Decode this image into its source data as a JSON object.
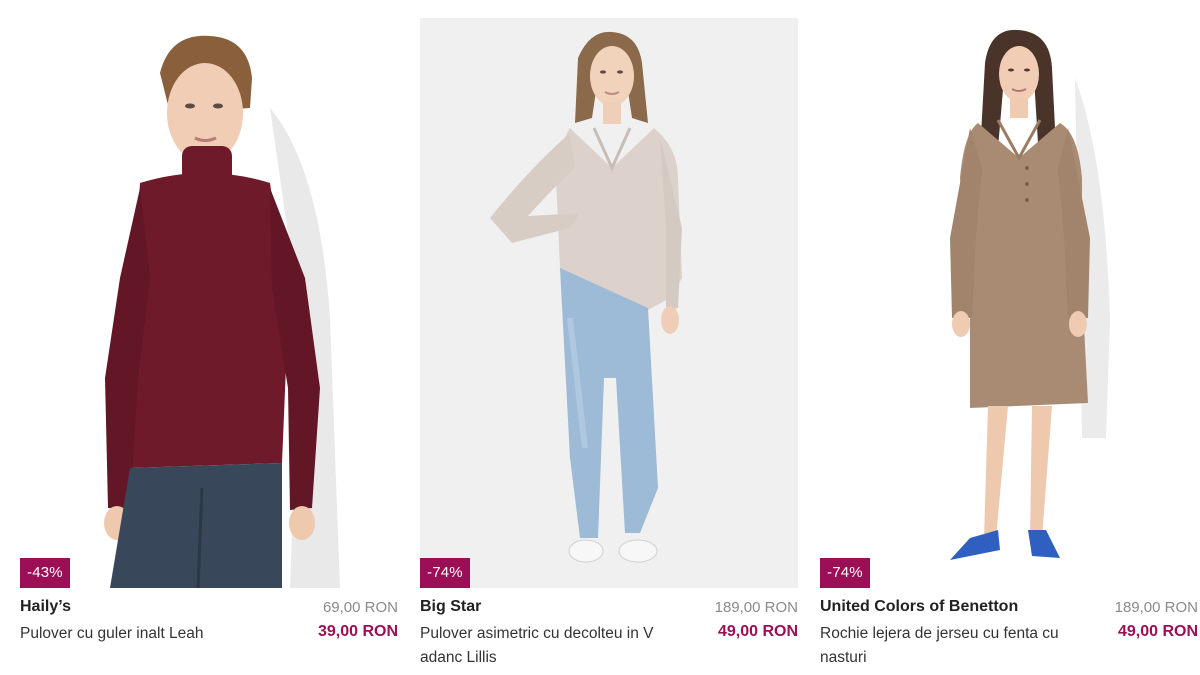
{
  "products": [
    {
      "discount": "-43%",
      "brand": "Haily’s",
      "name": "Pulover cu guler inalt Leah",
      "old_price": "69,00 RON",
      "new_price": "39,00 RON"
    },
    {
      "discount": "-74%",
      "brand": "Big Star",
      "name": "Pulover asimetric cu decolteu in V adanc Lillis",
      "old_price": "189,00 RON",
      "new_price": "49,00 RON"
    },
    {
      "discount": "-74%",
      "brand": "United Colors of Benetton",
      "name": "Rochie lejera de jerseu cu fenta cu nasturi",
      "old_price": "189,00 RON",
      "new_price": "49,00 RON"
    }
  ],
  "colors": {
    "accent": "#9c0f57",
    "sweater_burgundy": "#6e1a2b",
    "sweater_beige": "#dcd2cb",
    "dress_camel": "#a98b73",
    "jeans_dark": "#39475a",
    "jeans_light": "#9dbad6"
  }
}
